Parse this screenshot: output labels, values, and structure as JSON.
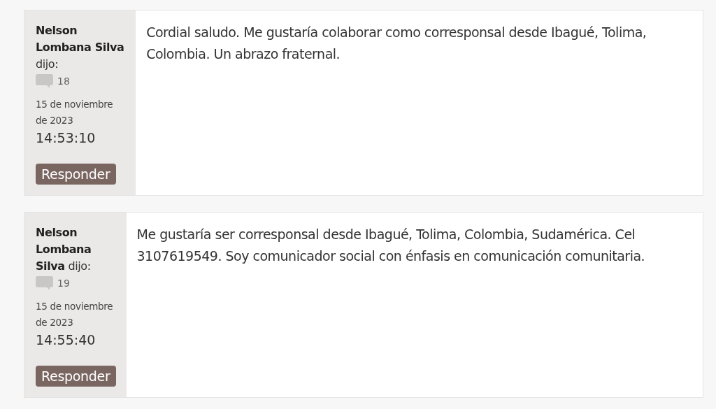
{
  "comments": [
    {
      "author_line": "**Nelson Lombana Silva** dijo:",
      "count": "18",
      "date": "15 de noviembre de 2023",
      "time": "14:53:10",
      "reply_button": "Responder",
      "text": "Cordial saludo. Me gustaría colaborar como corresponsal desde Ibagué, Tolima, Colombia. Un abrazo fraternal."
    },
    {
      "author_line": "**Nelson Lombana Silva** dijo:",
      "count": "19",
      "date": "15 de noviembre de 2023",
      "time": "14:55:40",
      "reply_button": "Responder",
      "text": "Me gustaría ser corresponsal desde Ibagué, Tolima, Colombia, Sudamérica. Cel 3107619549. Soy comunicador social con énfasis en comunicación comunitaria."
    }
  ]
}
